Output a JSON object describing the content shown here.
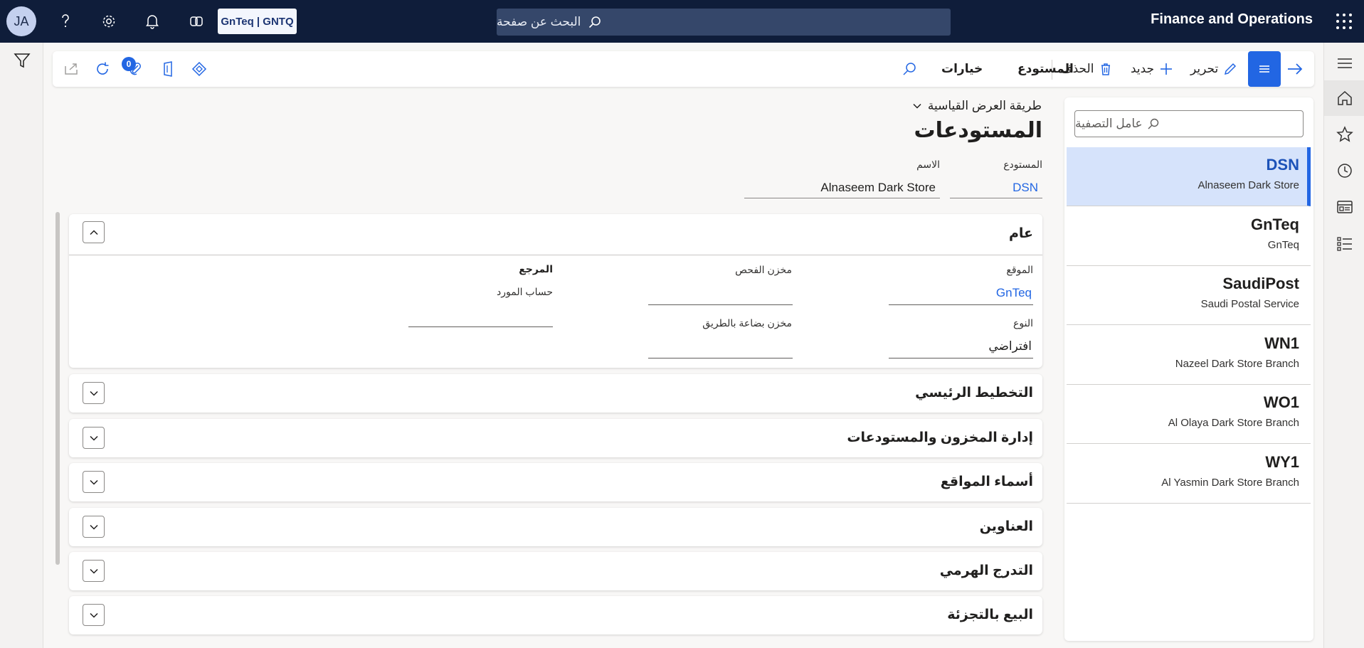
{
  "topbar": {
    "avatar_initials": "JA",
    "company": "GnTeq | GNTQ",
    "search_placeholder": "البحث عن صفحة",
    "app_title": "Finance and Operations"
  },
  "actionbar": {
    "edit": "تحرير",
    "new": "جديد",
    "delete": "الحذف",
    "warehouse_tab": "المستودع",
    "options_tab": "خيارات",
    "attachments_count": "0"
  },
  "list": {
    "filter_placeholder": "عامل التصفية",
    "items": [
      {
        "code": "DSN",
        "name": "Alnaseem Dark Store"
      },
      {
        "code": "GnTeq",
        "name": "GnTeq"
      },
      {
        "code": "SaudiPost",
        "name": "Saudi Postal Service"
      },
      {
        "code": "WN1",
        "name": "Nazeel Dark Store Branch"
      },
      {
        "code": "WO1",
        "name": "Al Olaya Dark Store Branch"
      },
      {
        "code": "WY1",
        "name": "Al Yasmin Dark Store Branch"
      }
    ]
  },
  "main": {
    "view_selector": "طريقة العرض القياسية",
    "page_title": "المستودعات",
    "header": {
      "warehouse_label": "المستودع",
      "warehouse_value": "DSN",
      "name_label": "الاسم",
      "name_value": "Alnaseem Dark Store"
    },
    "general": {
      "title": "عام",
      "site_label": "الموقع",
      "site_value": "GnTeq",
      "type_label": "النوع",
      "type_value": "افتراضي",
      "quarantine_label": "مخزن الفحص",
      "quarantine_value": "",
      "transit_label": "مخزن بضاعة بالطريق",
      "transit_value": "",
      "reference_label": "المرجع",
      "vendor_account_label": "حساب المورد",
      "vendor_account_value": ""
    },
    "sections": [
      "التخطيط الرئيسي",
      "إدارة المخزون والمستودعات",
      "أسماء المواقع",
      "العناوين",
      "التدرج الهرمي",
      "البيع بالتجزئة"
    ]
  },
  "colors": {
    "topbar_bg": "#0f1d3a",
    "accent": "#2266e3",
    "selected_row_bg": "#d6e3fb"
  }
}
